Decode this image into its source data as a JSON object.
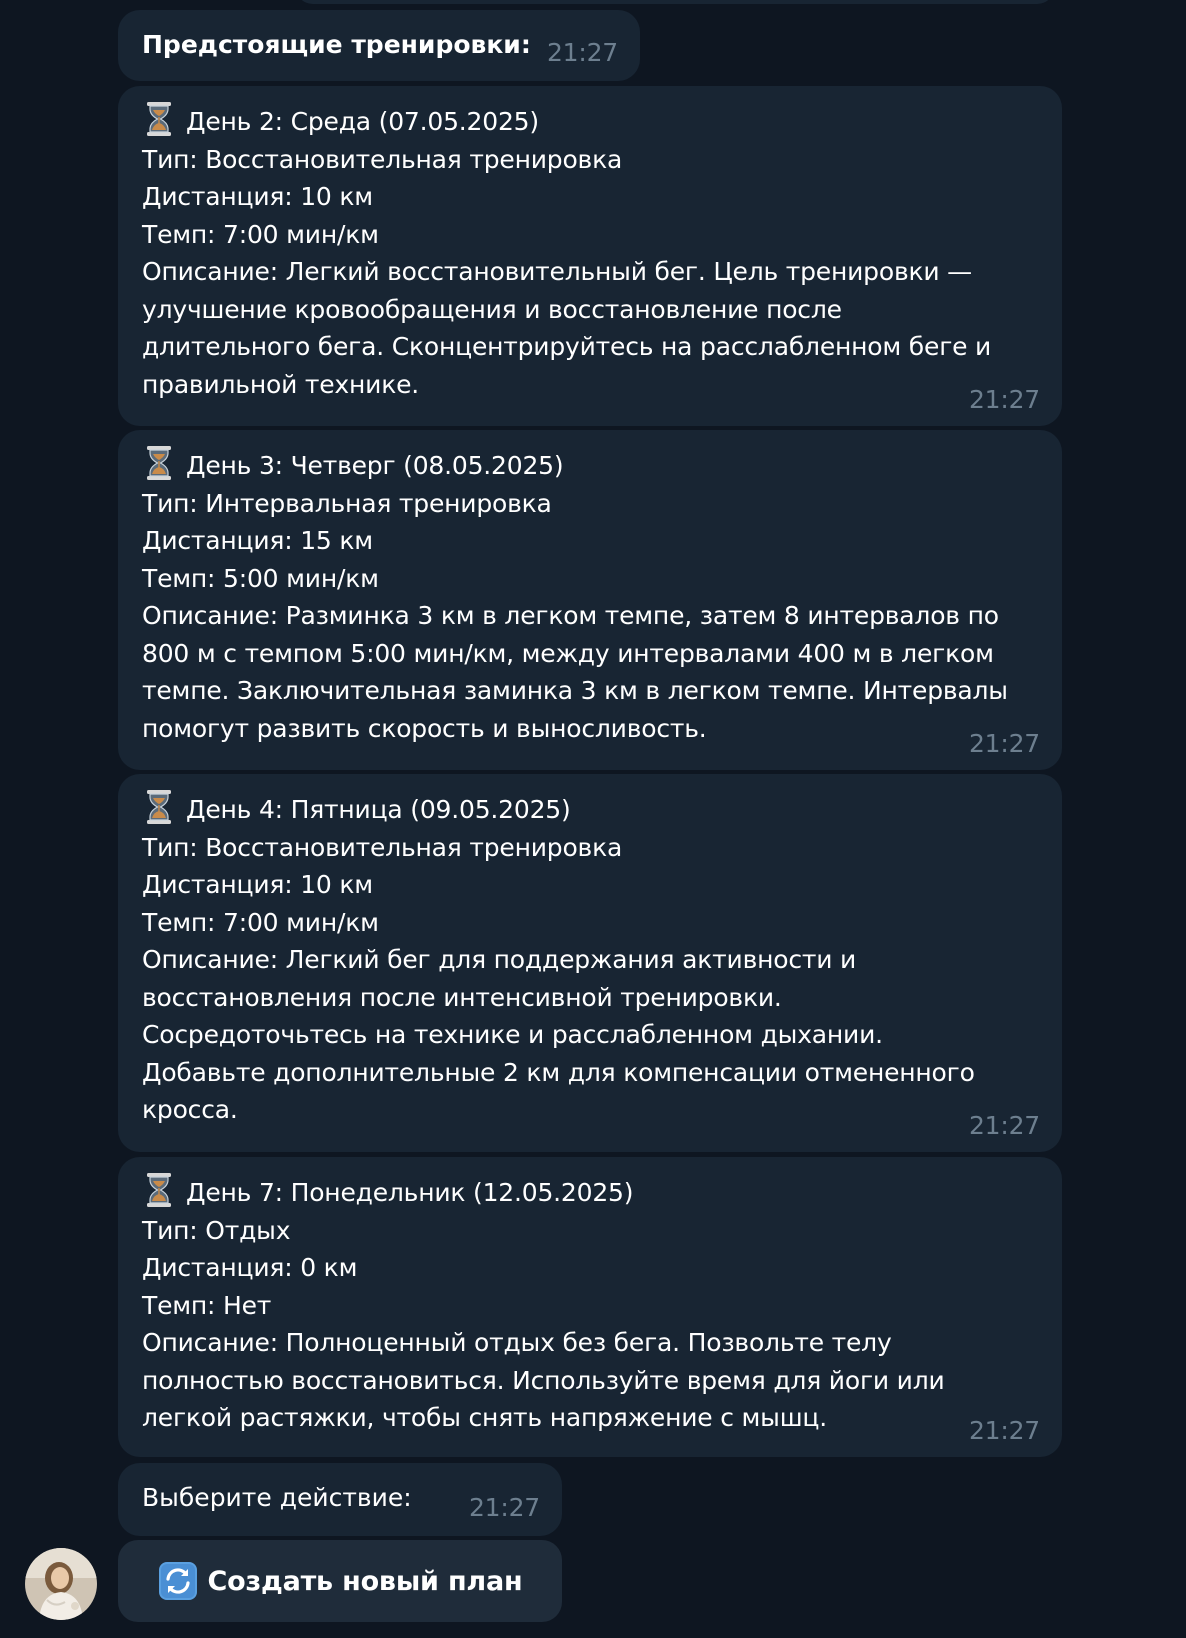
{
  "header_message": {
    "text": "Предстоящие тренировки:",
    "time": "21:27"
  },
  "workouts": [
    {
      "icon": "hourglass-icon",
      "day": "День 2: Среда (07.05.2025)",
      "type": "Тип: Восстановительная тренировка",
      "distance": "Дистанция: 10 км",
      "pace": "Темп: 7:00 мин/км",
      "description": [
        "Описание: Легкий восстановительный бег. Цель тренировки —",
        "улучшение кровообращения и восстановление после",
        "длительного бега. Сконцентрируйтесь на расслабленном беге и",
        "правильной технике."
      ],
      "time": "21:27"
    },
    {
      "icon": "hourglass-icon",
      "day": "День 3: Четверг (08.05.2025)",
      "type": "Тип: Интервальная тренировка",
      "distance": "Дистанция: 15 км",
      "pace": "Темп: 5:00 мин/км",
      "description": [
        "Описание: Разминка 3 км в легком темпе, затем 8 интервалов по",
        "800 м с темпом 5:00 мин/км, между интервалами 400 м в легком",
        "темпе. Заключительная заминка 3 км в легком темпе. Интервалы",
        "помогут развить скорость и выносливость."
      ],
      "time": "21:27"
    },
    {
      "icon": "hourglass-icon",
      "day": "День 4: Пятница (09.05.2025)",
      "type": "Тип: Восстановительная тренировка",
      "distance": "Дистанция: 10 км",
      "pace": "Темп: 7:00 мин/км",
      "description": [
        "Описание: Легкий бег для поддержания активности и",
        "восстановления после интенсивной тренировки.",
        "Сосредоточьтесь на технике и расслабленном дыхании.",
        "Добавьте дополнительные 2 км для компенсации отмененного",
        "кросса."
      ],
      "time": "21:27"
    },
    {
      "icon": "hourglass-icon",
      "day": "День 7: Понедельник (12.05.2025)",
      "type": "Тип: Отдых",
      "distance": "Дистанция: 0 км",
      "pace": "Темп: Нет",
      "description": [
        "Описание: Полноценный отдых без бега. Позвольте телу",
        "полностью восстановиться. Используйте время для йоги или",
        "легкой растяжки, чтобы снять напряжение с мышц."
      ],
      "time": "21:27"
    }
  ],
  "action_prompt": {
    "text": "Выберите действие:",
    "time": "21:27"
  },
  "inline_button": {
    "icon": "refresh-icon",
    "label": "Создать новый план"
  },
  "colors": {
    "background": "#0e1621",
    "bubble": "#182533",
    "button": "#1f2c3a",
    "timestamp": "#6d7f8f",
    "text": "#ffffff"
  }
}
